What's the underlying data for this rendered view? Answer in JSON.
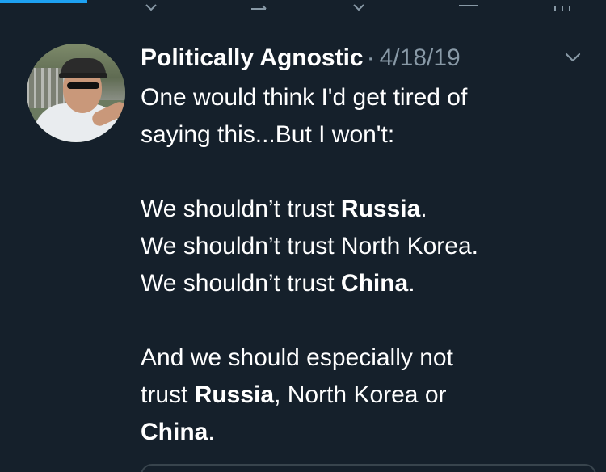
{
  "tweet": {
    "author_name": "Politically Agnostic",
    "separator": "·",
    "date": "4/18/19",
    "menu_icon": "chevron-down-icon",
    "lines": [
      {
        "parts": [
          {
            "text": "One would think I'd get tired of"
          }
        ]
      },
      {
        "parts": [
          {
            "text": "saying this...But I won't:"
          }
        ]
      },
      {
        "parts": []
      },
      {
        "parts": [
          {
            "text": "We shouldn’t trust "
          },
          {
            "text": "Russia",
            "bold": true
          },
          {
            "text": "."
          }
        ]
      },
      {
        "parts": [
          {
            "text": "We shouldn’t trust North Korea."
          }
        ]
      },
      {
        "parts": [
          {
            "text": "We shouldn’t trust "
          },
          {
            "text": "China",
            "bold": true
          },
          {
            "text": "."
          }
        ]
      },
      {
        "parts": []
      },
      {
        "parts": [
          {
            "text": "And we should especially not"
          }
        ]
      },
      {
        "parts": [
          {
            "text": "trust "
          },
          {
            "text": "Russia",
            "bold": true
          },
          {
            "text": ", North Korea or"
          }
        ]
      },
      {
        "parts": [
          {
            "text": "China",
            "bold": true
          },
          {
            "text": "."
          }
        ]
      }
    ]
  },
  "colors": {
    "background": "#15202b",
    "text": "#ffffff",
    "secondary_text": "#8899a6",
    "divider": "#38444d",
    "accent": "#1da1f2"
  }
}
